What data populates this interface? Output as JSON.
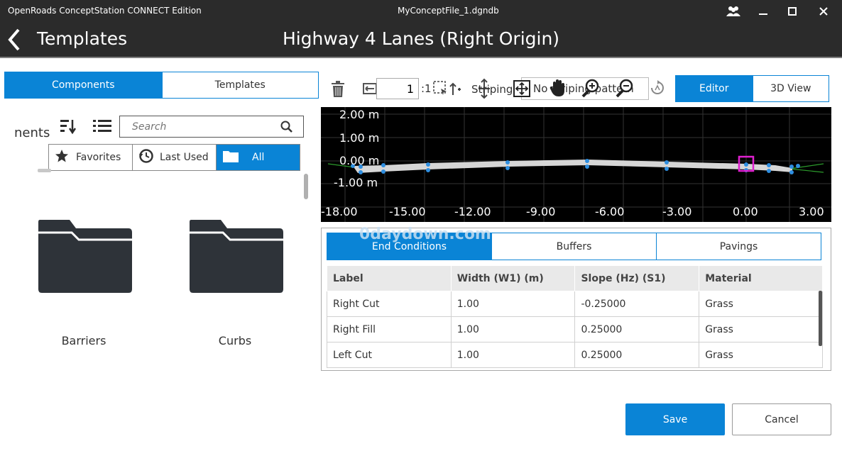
{
  "titlebar": {
    "app_name": "OpenRoads ConceptStation CONNECT Edition",
    "file_name": "MyConceptFile_1.dgndb"
  },
  "header": {
    "section_title": "Templates",
    "template_name": "Highway 4 Lanes (Right Origin)"
  },
  "library": {
    "tabs": [
      "Components",
      "Templates"
    ],
    "active_tab": "Components",
    "heading": "nents",
    "search_placeholder": "Search",
    "filters": [
      "Favorites",
      "Last Used",
      "All"
    ],
    "active_filter": "All",
    "folders": [
      "Barriers",
      "Curbs"
    ]
  },
  "toolbar": {
    "scale_value": "1",
    "scale_suffix": ":1",
    "striping_label": "Striping:",
    "striping_value": "No striping pattern",
    "view_tabs": [
      "Editor",
      "3D View"
    ],
    "active_view": "Editor"
  },
  "canvas": {
    "y_labels": [
      "2.00 m",
      "1.00 m",
      "0.00 m",
      "-1.00 m"
    ],
    "x_labels": [
      "-18.00",
      "-15.00",
      "-12.00",
      "-9.00",
      "-6.00",
      "-3.00",
      "0.00",
      "3.00"
    ]
  },
  "properties": {
    "tabs": [
      "End Conditions",
      "Buffers",
      "Pavings"
    ],
    "active_tab": "End Conditions",
    "columns": [
      "Label",
      "Width (W1) (m)",
      "Slope (Hz) (S1)",
      "Material"
    ],
    "rows": [
      [
        "Right Cut",
        "1.00",
        "-0.25000",
        "Grass"
      ],
      [
        "Right Fill",
        "1.00",
        "0.25000",
        "Grass"
      ],
      [
        "Left Cut",
        "1.00",
        "0.25000",
        "Grass"
      ]
    ]
  },
  "actions": {
    "save_label": "Save",
    "cancel_label": "Cancel"
  },
  "watermark": "0daydown.com",
  "colors": {
    "accent": "#0a84d6",
    "dark": "#2b2b2b",
    "selection": "#e020d0"
  }
}
